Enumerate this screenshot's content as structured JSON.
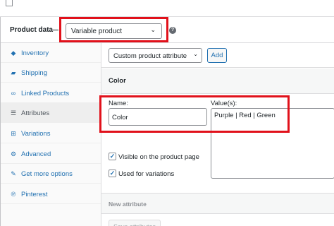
{
  "product_data": {
    "label": "Product data",
    "type_select": "Variable product",
    "help_icon": "help-icon"
  },
  "sidebar": {
    "items": [
      {
        "label": "Inventory",
        "icon": "inventory-icon",
        "glyph": "◆",
        "active": false
      },
      {
        "label": "Shipping",
        "icon": "truck-icon",
        "glyph": "▰",
        "active": false
      },
      {
        "label": "Linked Products",
        "icon": "link-icon",
        "glyph": "∞",
        "active": false
      },
      {
        "label": "Attributes",
        "icon": "list-icon",
        "glyph": "☰",
        "active": true
      },
      {
        "label": "Variations",
        "icon": "grid-icon",
        "glyph": "⊞",
        "active": false
      },
      {
        "label": "Advanced",
        "icon": "gear-icon",
        "glyph": "⚙",
        "active": false
      },
      {
        "label": "Get more options",
        "icon": "plug-icon",
        "glyph": "✎",
        "active": false
      },
      {
        "label": "Pinterest",
        "icon": "pinterest-icon",
        "glyph": "℗",
        "active": false
      }
    ]
  },
  "toolbar": {
    "attr_select": "Custom product attribute",
    "add_label": "Add"
  },
  "attribute": {
    "title": "Color",
    "name_label": "Name:",
    "name_value": "Color",
    "values_label": "Value(s):",
    "values_value": "Purple | Red | Green",
    "visible_label": "Visible on the product page",
    "visible_checked": true,
    "variations_label": "Used for variations",
    "variations_checked": true
  },
  "new_attribute": {
    "label": "New attribute"
  },
  "save_label": "Save attributes",
  "colors": {
    "highlight": "#e1111b",
    "link": "#2271b1"
  }
}
